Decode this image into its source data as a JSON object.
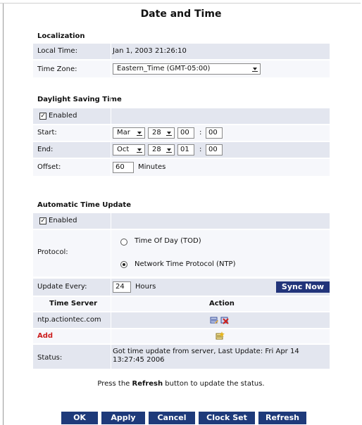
{
  "page": {
    "title": "Date and Time"
  },
  "localization": {
    "heading": "Localization",
    "local_time_label": "Local Time:",
    "local_time_value": "Jan 1, 2003 21:26:10",
    "time_zone_label": "Time Zone:",
    "time_zone_value": "Eastern_Time (GMT-05:00)"
  },
  "dst": {
    "heading": "Daylight Saving Time",
    "enabled_label": "Enabled",
    "enabled_checked": true,
    "start_label": "Start:",
    "start_month": "Mar",
    "start_day": "28",
    "start_hour": "00",
    "start_minute": "00",
    "end_label": "End:",
    "end_month": "Oct",
    "end_day": "28",
    "end_hour": "01",
    "end_minute": "00",
    "colon": ":",
    "offset_label": "Offset:",
    "offset_value": "60",
    "offset_unit": "Minutes"
  },
  "auto_update": {
    "heading": "Automatic Time Update",
    "enabled_label": "Enabled",
    "enabled_checked": true,
    "protocol_label": "Protocol:",
    "protocol_tod": "Time Of Day (TOD)",
    "protocol_ntp": "Network Time Protocol (NTP)",
    "protocol_selected": "ntp",
    "update_every_label": "Update Every:",
    "update_every_value": "24",
    "update_every_unit": "Hours",
    "sync_now": "Sync Now",
    "col_time_server": "Time Server",
    "col_action": "Action",
    "server_1": "ntp.actiontec.com",
    "add_label": "Add",
    "status_label": "Status:",
    "status_value": "Got time update from server, Last Update: Fri Apr 14 13:27:45 2006"
  },
  "footer": {
    "note_prefix": "Press the ",
    "note_bold": "Refresh",
    "note_suffix": " button to update the status.",
    "buttons": {
      "ok": "OK",
      "apply": "Apply",
      "cancel": "Cancel",
      "clock_set": "Clock Set",
      "refresh": "Refresh"
    }
  },
  "colors": {
    "row_dark": "#e3e6ef",
    "row_light": "#f6f7fb",
    "button": "#1e3a7a",
    "add_red": "#cc1f1f"
  }
}
